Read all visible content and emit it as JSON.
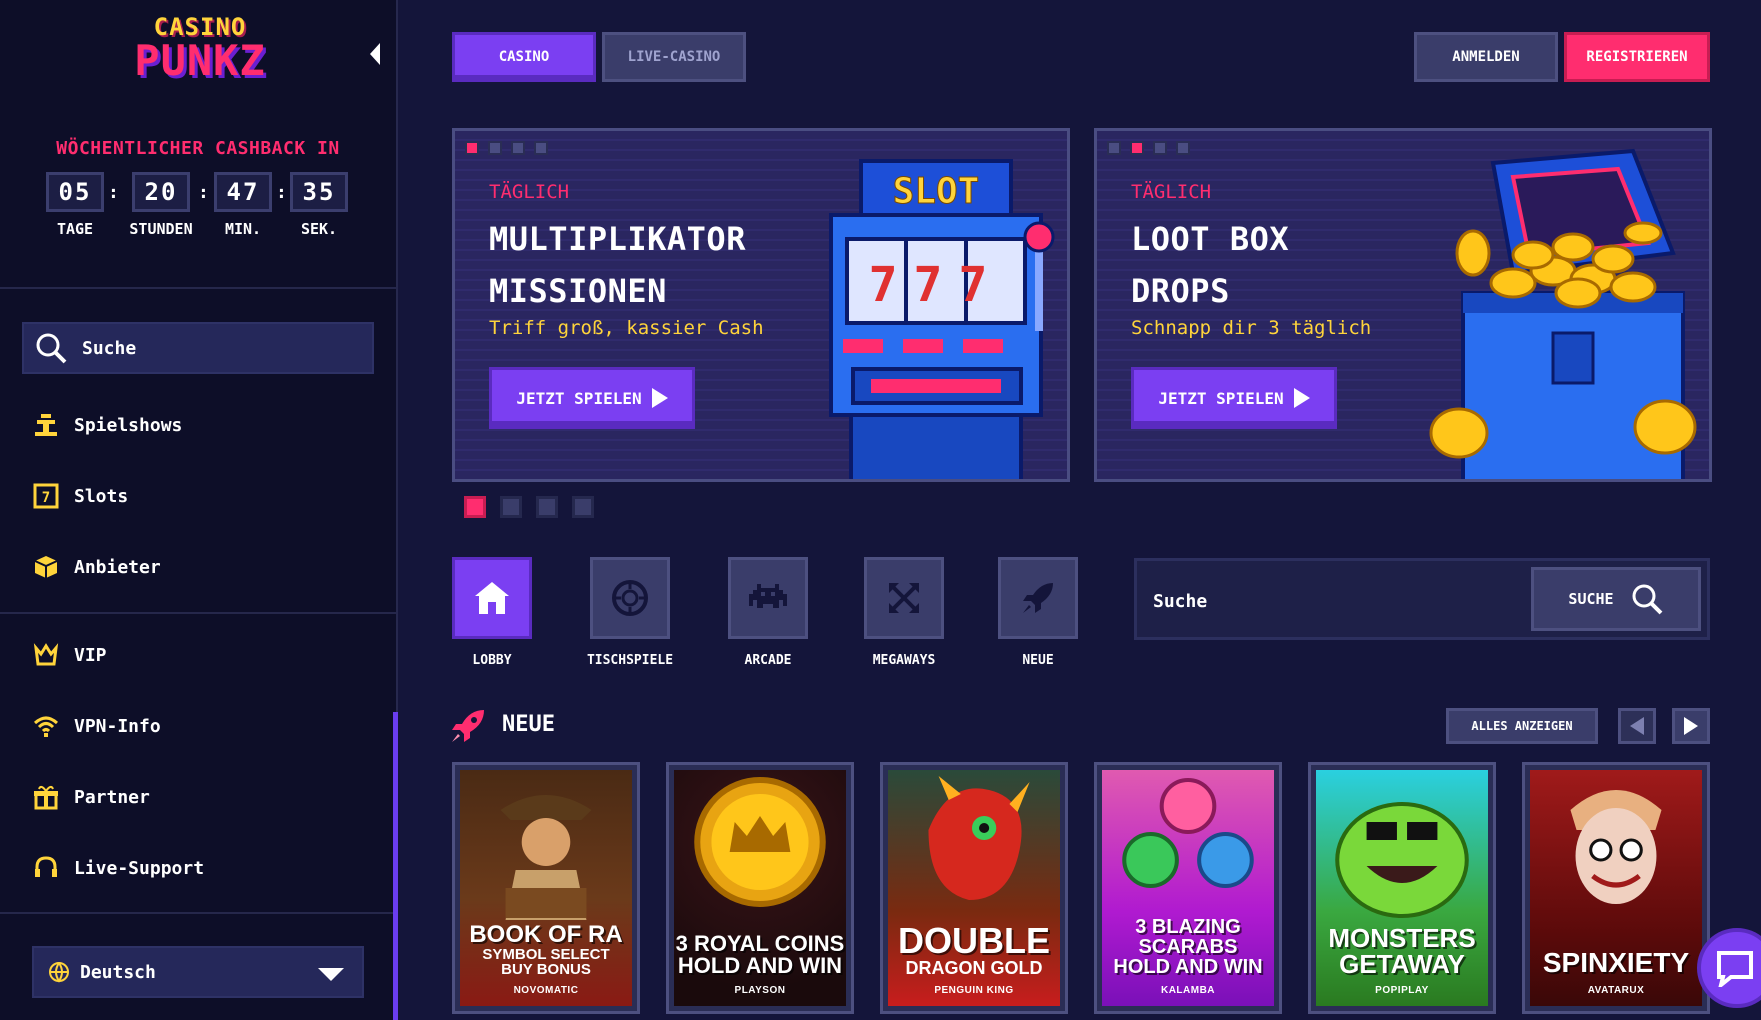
{
  "brand": {
    "logo_line1": "CASINO",
    "logo_line2": "PUNKZ"
  },
  "cashback": {
    "title": "WÖCHENTLICHER CASHBACK IN",
    "units": [
      {
        "value": "05",
        "label": "TAGE"
      },
      {
        "value": "20",
        "label": "STUNDEN"
      },
      {
        "value": "47",
        "label": "MIN."
      },
      {
        "value": "35",
        "label": "SEK."
      }
    ]
  },
  "sidebar": {
    "search_label": "Suche",
    "items": [
      {
        "label": "Spielshows",
        "icon": "podium-icon"
      },
      {
        "label": "Slots",
        "icon": "slot-icon"
      },
      {
        "label": "Anbieter",
        "icon": "box-icon"
      },
      {
        "label": "VIP",
        "icon": "crown-icon"
      },
      {
        "label": "VPN-Info",
        "icon": "wifi-icon"
      },
      {
        "label": "Partner",
        "icon": "gift-icon"
      },
      {
        "label": "Live-Support",
        "icon": "headset-icon"
      }
    ],
    "language": "Deutsch"
  },
  "topbar": {
    "tabs": [
      "CASINO",
      "LIVE-CASINO"
    ],
    "login": "ANMELDEN",
    "register": "REGISTRIEREN"
  },
  "promos": [
    {
      "kicker": "TÄGLICH",
      "title_line1": "MULTIPLIKATOR",
      "title_line2": "MISSIONEN",
      "subtitle": "Triff groß, kassier Cash",
      "cta": "JETZT SPIELEN",
      "art_text": "SLOT",
      "art_reels": "777"
    },
    {
      "kicker": "TÄGLICH",
      "title_line1": "LOOT BOX",
      "title_line2": "DROPS",
      "subtitle": "Schnapp dir 3 täglich",
      "cta": "JETZT SPIELEN"
    }
  ],
  "categories": [
    "LOBBY",
    "TISCHSPIELE",
    "ARCADE",
    "MEGAWAYS",
    "NEUE"
  ],
  "search": {
    "placeholder": "Suche",
    "button": "SUCHE"
  },
  "section": {
    "title": "NEUE",
    "show_all": "ALLES ANZEIGEN"
  },
  "games": [
    {
      "title": "BOOK OF RA",
      "subtitle": "SYMBOL SELECT\nBUY BONUS",
      "provider": "NOVOMATIC"
    },
    {
      "title": "3 ROYAL COINS\nHOLD AND WIN",
      "subtitle": "",
      "provider": "PLAYSON"
    },
    {
      "title": "DOUBLE",
      "subtitle": "DRAGON GOLD",
      "provider": "PENGUIN KING"
    },
    {
      "title": "3 BLAZING\nSCARABS\nHOLD AND WIN",
      "subtitle": "",
      "provider": "KALAMBA"
    },
    {
      "title": "MONSTERS\nGETAWAY",
      "subtitle": "",
      "provider": "POPIPLAY"
    },
    {
      "title": "SPINXIETY",
      "subtitle": "",
      "provider": "AVATARUX"
    }
  ],
  "colors": {
    "bg": "#14153a",
    "sidebar": "#0d0e28",
    "accent_purple": "#7b3ff2",
    "accent_pink": "#ff2d6f",
    "gold": "#ffd43b"
  }
}
